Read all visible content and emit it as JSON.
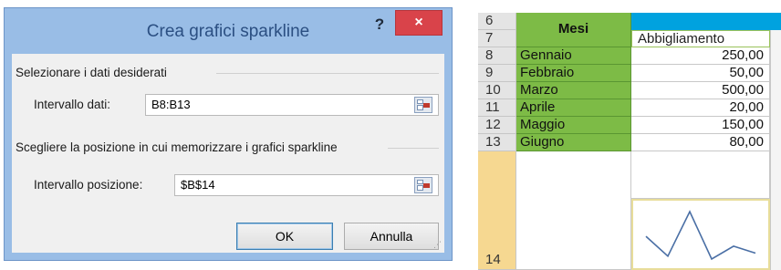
{
  "dialog": {
    "title": "Crea grafici sparkline",
    "help_label": "?",
    "close_label": "×",
    "data_group_label": "Selezionare i dati desiderati",
    "data_range_label": "Intervallo dati:",
    "data_range_value": "B8:B13",
    "location_group_label": "Scegliere la posizione in cui memorizzare i grafici sparkline",
    "location_range_label": "Intervallo posizione:",
    "location_range_value": "$B$14",
    "ok_label": "OK",
    "cancel_label": "Annulla"
  },
  "sheet": {
    "header_row_numbers": [
      "6",
      "7"
    ],
    "merged_header": "Mesi",
    "column_b_header": "Abbigliamento",
    "rows": [
      {
        "row": "8",
        "month": "Gennaio",
        "value": "250,00"
      },
      {
        "row": "9",
        "month": "Febbraio",
        "value": "50,00"
      },
      {
        "row": "10",
        "month": "Marzo",
        "value": "500,00"
      },
      {
        "row": "11",
        "month": "Aprile",
        "value": "20,00"
      },
      {
        "row": "12",
        "month": "Maggio",
        "value": "150,00"
      },
      {
        "row": "13",
        "month": "Giugno",
        "value": "80,00"
      }
    ],
    "sparkline_row": "14",
    "sparkline_values": [
      250,
      50,
      500,
      20,
      150,
      80
    ],
    "colors": {
      "month_fill": "#7dbb46",
      "header_band": "#00a2df",
      "selected_row": "#f6d891",
      "sparkline": "#4a6fa5"
    }
  }
}
